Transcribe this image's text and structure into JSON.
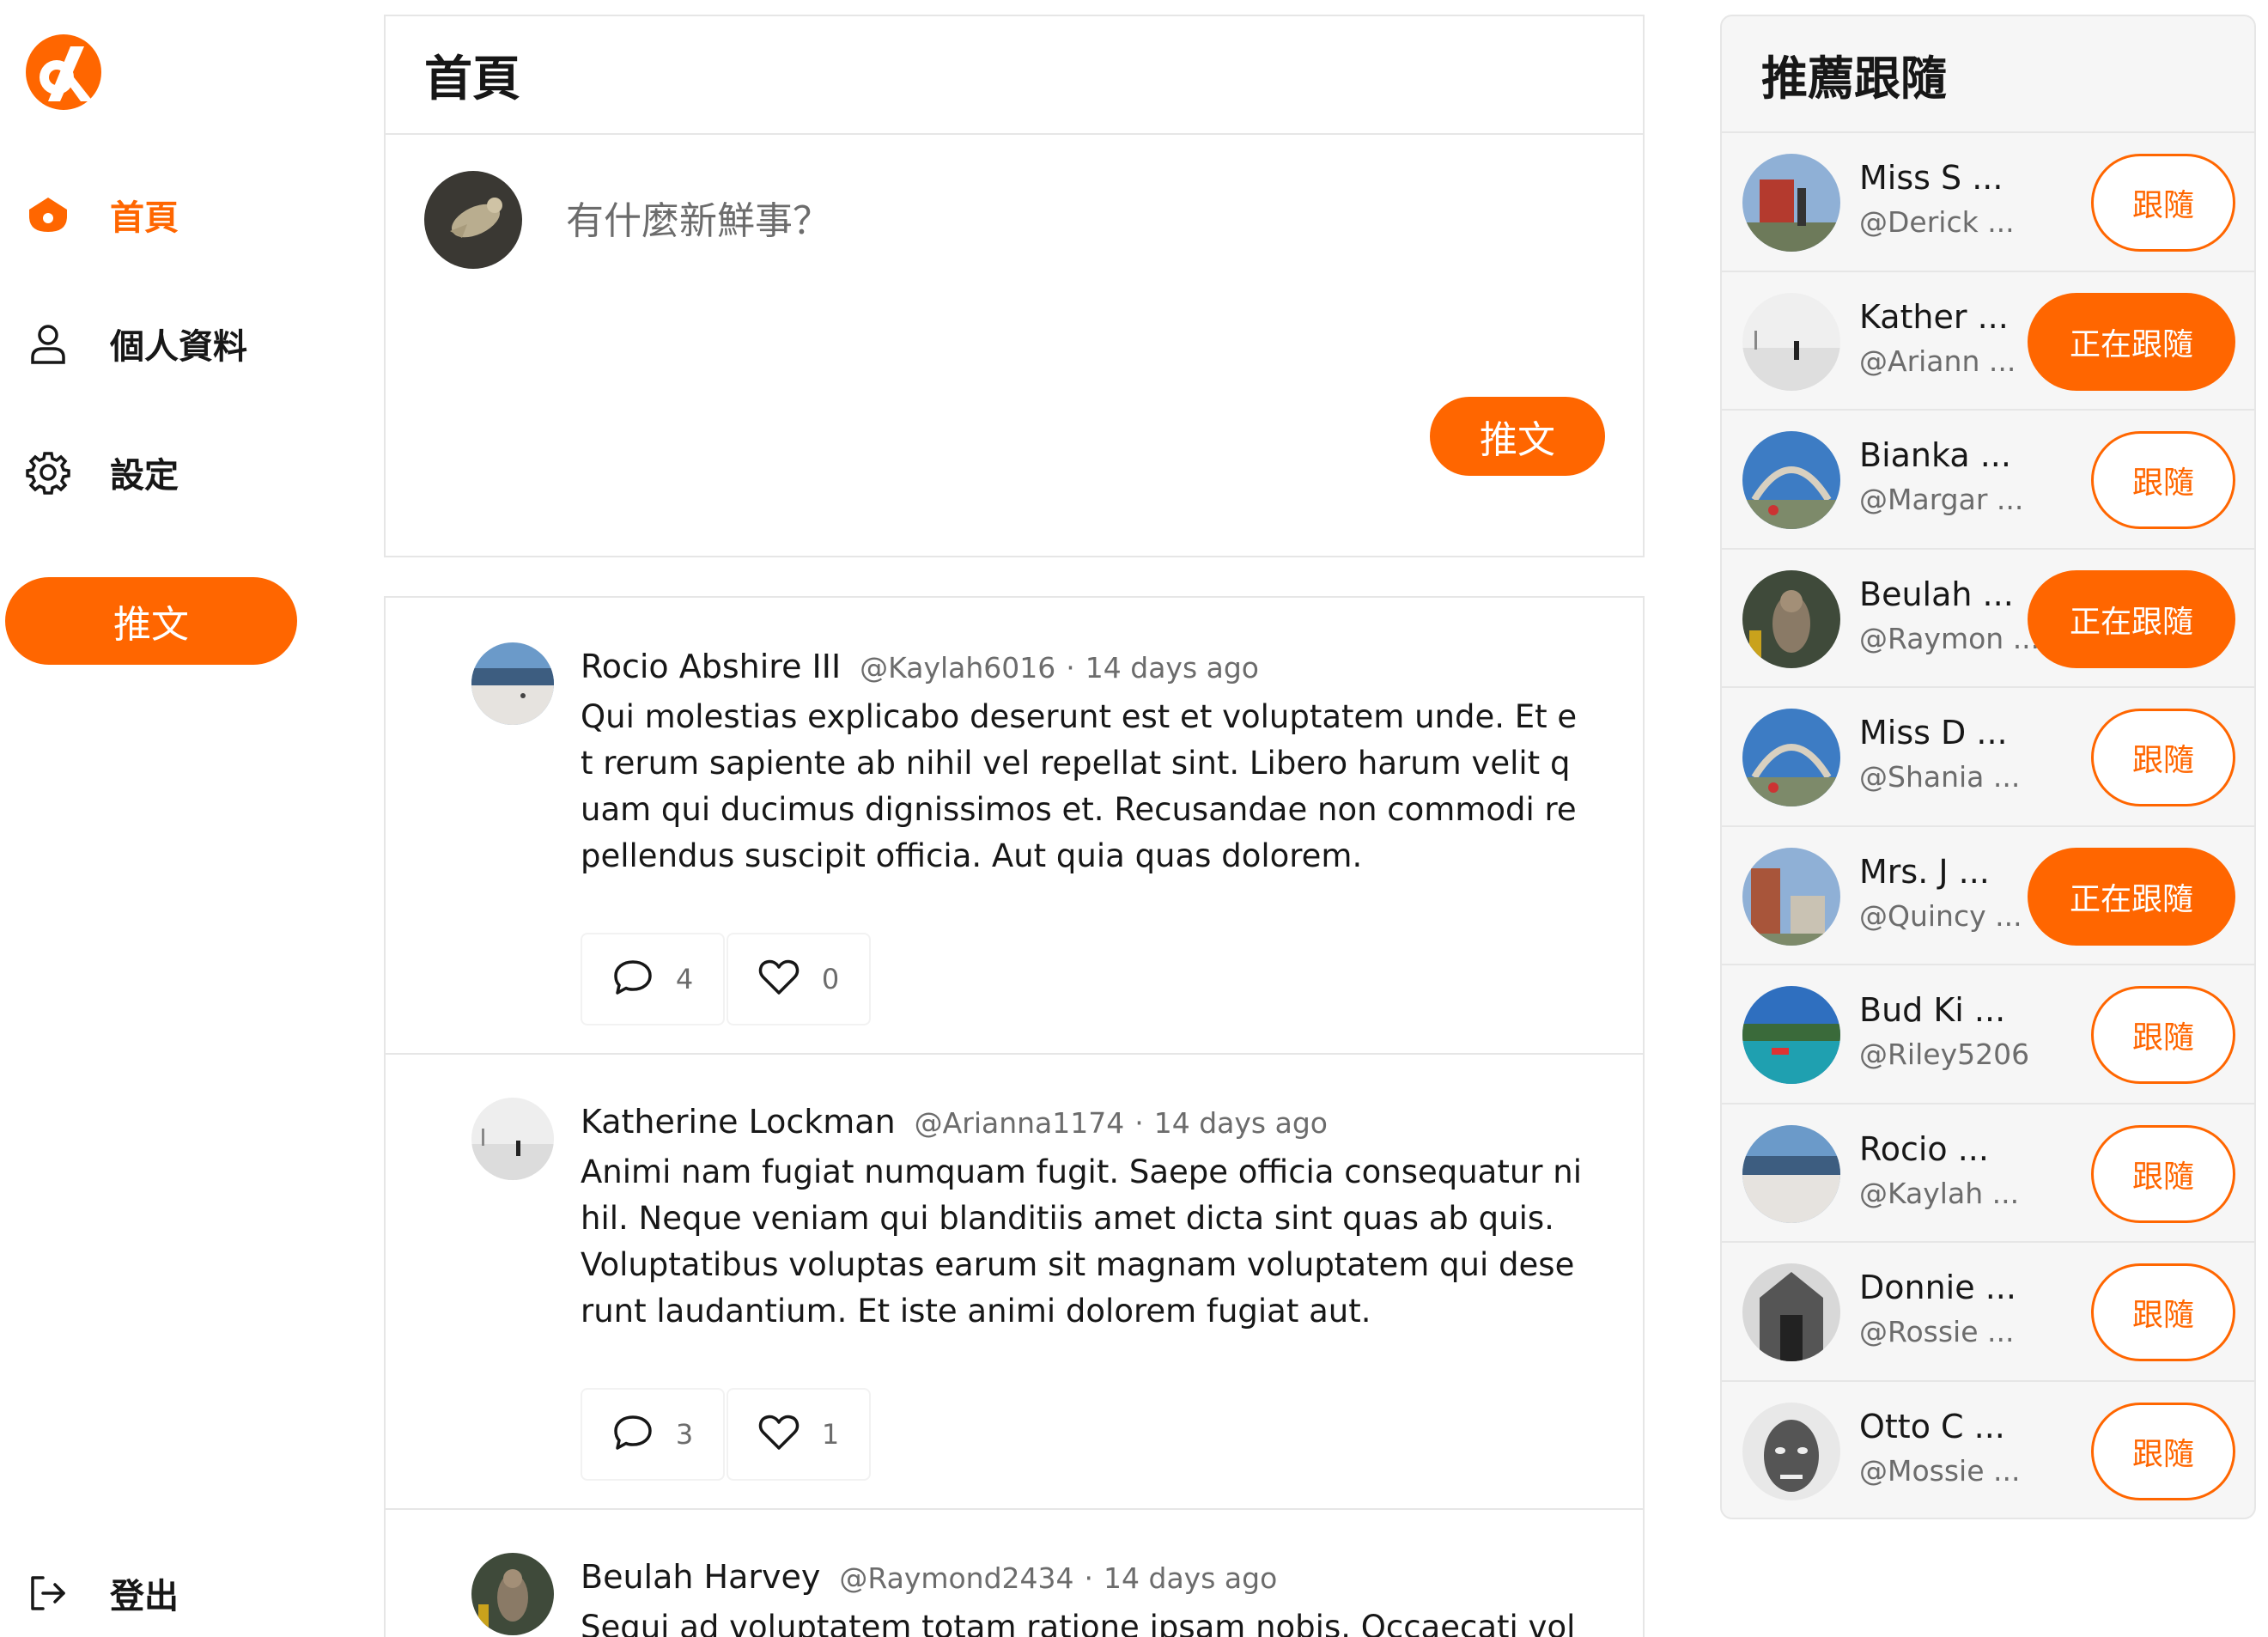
{
  "colors": {
    "accent": "#ff6600",
    "text": "#171717",
    "muted": "#6c6c6c",
    "border": "#e6e6e6"
  },
  "nav": {
    "items": [
      {
        "label": "首頁",
        "icon": "home-icon",
        "active": true
      },
      {
        "label": "個人資料",
        "icon": "user-icon",
        "active": false
      },
      {
        "label": "設定",
        "icon": "gear-icon",
        "active": false
      }
    ],
    "tweet_button": "推文",
    "logout": {
      "label": "登出",
      "icon": "logout-icon"
    }
  },
  "main": {
    "title": "首頁",
    "composer": {
      "placeholder": "有什麼新鮮事？",
      "submit_label": "推文"
    },
    "tweets": [
      {
        "name": "Rocio Abshire III",
        "handle": "@Kaylah6016",
        "time": "14 days ago",
        "body": "Qui molestias explicabo deserunt est et voluptatem unde. Et et rerum sapiente ab nihil vel repellat sint. Libero harum velit quam qui ducimus dignissimos et. Recusandae non commodi repellendus suscipit officia. Aut quia quas dolorem.",
        "replies": "4",
        "likes": "0"
      },
      {
        "name": "Katherine Lockman",
        "handle": "@Arianna1174",
        "time": "14 days ago",
        "body": "Animi nam fugiat numquam fugit. Saepe officia consequatur nihil. Neque veniam qui blanditiis amet dicta sint quas ab quis. Voluptatibus voluptas earum sit magnam voluptatem qui deserunt laudantium. Et iste animi dolorem fugiat aut.",
        "replies": "3",
        "likes": "1"
      },
      {
        "name": "Beulah Harvey",
        "handle": "@Raymond2434",
        "time": "14 days ago",
        "body": "Sequi ad voluptatem totam ratione ipsam nobis. Occaecati voluptas",
        "replies": "",
        "likes": ""
      }
    ]
  },
  "recommendations": {
    "title": "推薦跟隨",
    "follow_label": "跟隨",
    "following_label": "正在跟隨",
    "users": [
      {
        "name": "Miss S ...",
        "handle": "@Derick ...",
        "following": false
      },
      {
        "name": "Kather ...",
        "handle": "@Ariann ...",
        "following": true
      },
      {
        "name": "Bianka ...",
        "handle": "@Margar ...",
        "following": false
      },
      {
        "name": "Beulah ...",
        "handle": "@Raymon ...",
        "following": true
      },
      {
        "name": "Miss D ...",
        "handle": "@Shania ...",
        "following": false
      },
      {
        "name": "Mrs. J ...",
        "handle": "@Quincy ...",
        "following": true
      },
      {
        "name": "Bud Ki ...",
        "handle": "@Riley5206",
        "following": false
      },
      {
        "name": "Rocio ...",
        "handle": "@Kaylah ...",
        "following": false
      },
      {
        "name": "Donnie ...",
        "handle": "@Rossie ...",
        "following": false
      },
      {
        "name": "Otto C ...",
        "handle": "@Mossie ...",
        "following": false
      }
    ]
  }
}
